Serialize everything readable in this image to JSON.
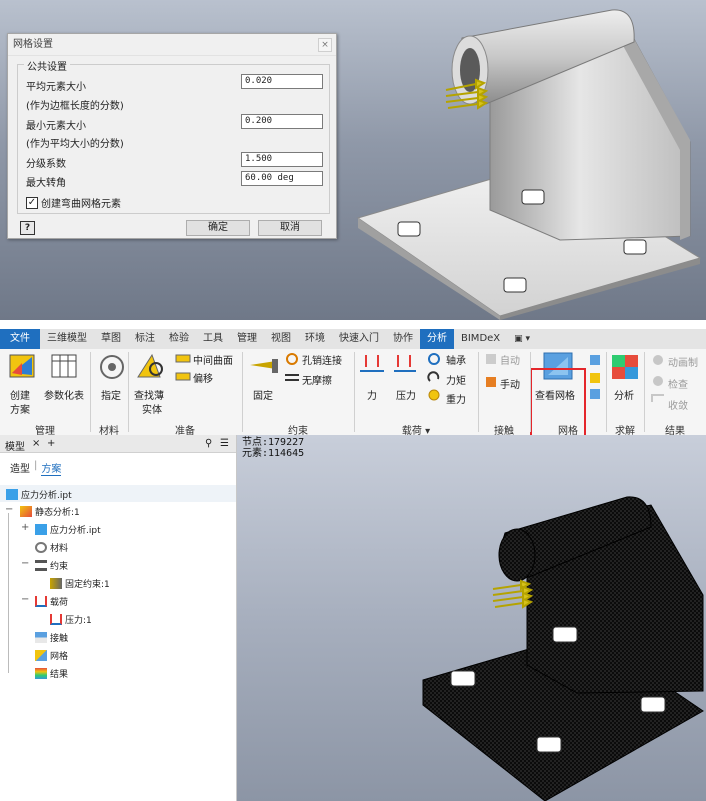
{
  "dialog": {
    "title": "网格设置",
    "close_glyph": "×",
    "group_title": "公共设置",
    "avg_label": "平均元素大小",
    "avg_note": "(作为边框长度的分数)",
    "avg_value": "0.020",
    "min_label": "最小元素大小",
    "min_note": "(作为平均大小的分数)",
    "min_value": "0.200",
    "grade_label": "分级系数",
    "grade_value": "1.500",
    "turn_label": "最大转角",
    "turn_value": "60.00 deg",
    "curved_label": "创建弯曲网格元素",
    "curved_checked": true,
    "help_glyph": "?",
    "ok_label": "确定",
    "cancel_label": "取消"
  },
  "ribbon": {
    "tabs": [
      "文件",
      "三维模型",
      "草图",
      "标注",
      "检验",
      "工具",
      "管理",
      "视图",
      "环境",
      "快速入门",
      "协作",
      "分析",
      "BIMDeX",
      "▣ ▾"
    ],
    "active_tab": "分析",
    "groups": {
      "manage": {
        "label": "管理",
        "create_line1": "创建",
        "create_line2": "方案",
        "param_table": "参数化表"
      },
      "material": {
        "label": "材料",
        "assign": "指定"
      },
      "prepare": {
        "label": "准备",
        "find_line1": "查找薄",
        "find_line2": "实体",
        "midsurface": "中间曲面",
        "offset": "偏移"
      },
      "constraints": {
        "label": "约束",
        "fixed": "固定",
        "pin": "孔销连接",
        "frictionless": "无摩擦"
      },
      "loads": {
        "label": "载荷 ▾",
        "force": "力",
        "pressure": "压力",
        "bearing": "轴承",
        "moment": "力矩",
        "gravity": "重力"
      },
      "contacts": {
        "label": "接触",
        "auto": "自动",
        "manual": "手动"
      },
      "mesh": {
        "label": "网格",
        "view_mesh": "查看网格"
      },
      "solve": {
        "label": "求解",
        "analyze": "分析"
      },
      "result": {
        "label": "结果",
        "animate": "动画制",
        "probe": "检查",
        "converge": "收敛"
      }
    },
    "colors": {
      "accent": "#1f6fbf",
      "highlight": "#e4262b"
    }
  },
  "browser": {
    "header_label": "模型",
    "close_glyph": "×",
    "add_glyph": "+",
    "search_glyph": "⚲",
    "menu_glyph": "☰",
    "tab_model": "造型",
    "tab_plan": "方案",
    "root": "应力分析.ipt",
    "study": "静态分析:1",
    "part": "应力分析.ipt",
    "materials": "材料",
    "constraints": "约束",
    "fixed_constraint": "固定约束:1",
    "loads": "载荷",
    "pressure_load": "压力:1",
    "contacts": "接触",
    "mesh": "网格",
    "results": "结果"
  },
  "viewport": {
    "nodes_text": "节点:179227",
    "elements_text": "元素:114645"
  }
}
